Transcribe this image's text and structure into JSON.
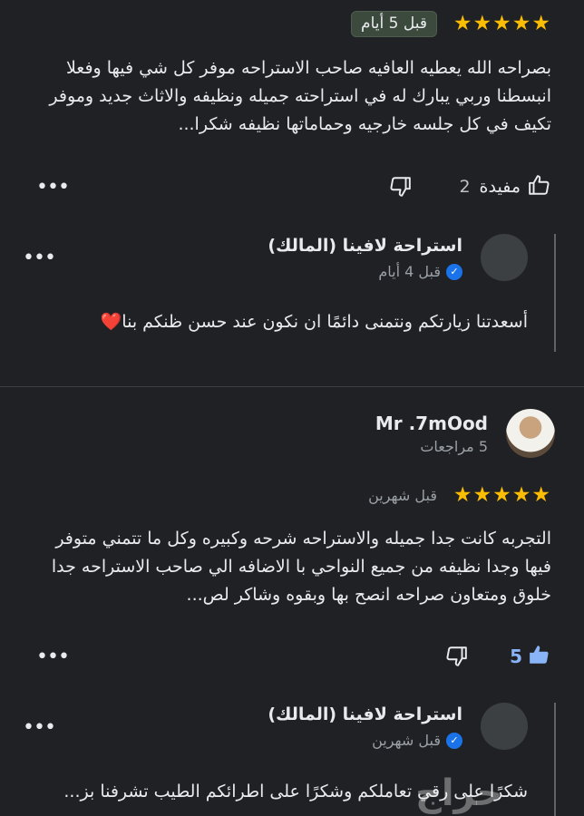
{
  "review1": {
    "stars": "★★★★★",
    "time": "قبل 5 أيام",
    "text": "بصراحه الله يعطيه العافيه صاحب الاستراحه موفر كل شي فيها وفعلا انبسطنا وربي يبارك له في استراحته جميله ونظيفه والاثاث جديد وموفر تكيف في كل جلسه خارجيه وحماماتها نظيفه شكرا...",
    "helpful_label": "مفيدة",
    "helpful_count": "2",
    "more": "•••"
  },
  "reply1": {
    "owner_name": "استراحة لافينا (المالك)",
    "time": "قبل 4 أيام",
    "text": "أسعدتنا زيارتكم ونتمنى دائمًا ان نكون عند حسن ظنكم بنا❤️",
    "more": "•••"
  },
  "review2": {
    "author": "Mr .7mOod",
    "review_count": "5 مراجعات",
    "stars": "★★★★★",
    "time": "قبل شهرين",
    "text": "التجربه كانت جدا جميله والاستراحه شرحه وكبيره وكل ما تتمني متوفر فيها وجدا نظيفه من جميع النواحي  با الاضافه الي صاحب الاستراحه جدا خلوق ومتعاون صراحه انصح بها وبقوه وشاكر لص...",
    "helpful_count": "5",
    "more": "•••"
  },
  "reply2": {
    "owner_name": "استراحة لافينا (المالك)",
    "time": "قبل شهرين",
    "text": "شكرًا على رقي تعاملكم وشكرًا على اطرائكم الطيب تشرفنا بز...",
    "more": "•••"
  },
  "watermark": "حراج",
  "colors": {
    "star": "#fbbc04",
    "accent": "#8ab4f8",
    "verified": "#1a73e8"
  }
}
